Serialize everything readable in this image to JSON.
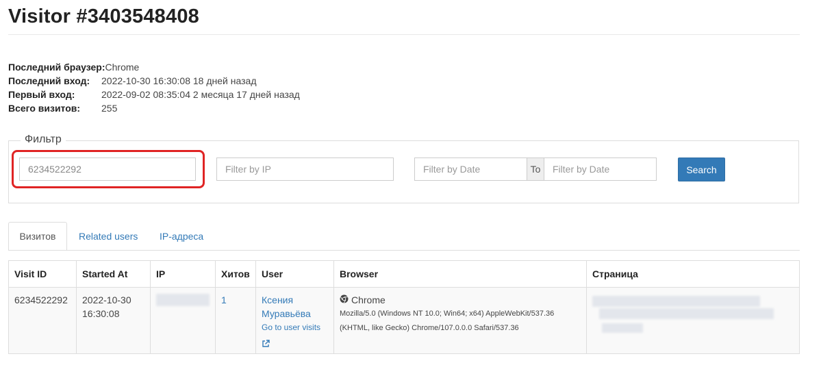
{
  "title": "Visitor #3403548408",
  "info": [
    {
      "key": "Последний браузер:",
      "value": "Chrome"
    },
    {
      "key": "Последний вход:",
      "value": "2022-10-30 16:30:08 18 дней назад"
    },
    {
      "key": "Первый вход:",
      "value": "2022-09-02 08:35:04 2 месяца 17 дней назад"
    },
    {
      "key": "Всего визитов:",
      "value": "255"
    }
  ],
  "filter": {
    "legend": "Фильтр",
    "visitor_value": "6234522292",
    "ip_placeholder": "Filter by IP",
    "date_from_placeholder": "Filter by Date",
    "to_label": "To",
    "date_to_placeholder": "Filter by Date",
    "search_label": "Search"
  },
  "tabs": [
    {
      "label": "Визитов",
      "active": true
    },
    {
      "label": "Related users",
      "active": false
    },
    {
      "label": "IP-адреса",
      "active": false
    }
  ],
  "table": {
    "headers": [
      "Visit ID",
      "Started At",
      "IP",
      "Хитов",
      "User",
      "Browser",
      "Страница"
    ],
    "rows": [
      {
        "visit_id": "6234522292",
        "started_date": "2022-10-30",
        "started_time": "16:30:08",
        "hits": "1",
        "user_first": "Ксения",
        "user_last": "Муравьёва",
        "user_link": "Go to user visits",
        "browser": "Chrome",
        "ua_line1": "Mozilla/5.0 (Windows NT 10.0; Win64; x64) AppleWebKit/537.36",
        "ua_line2": "(KHTML, like Gecko) Chrome/107.0.0.0 Safari/537.36"
      }
    ]
  },
  "colors": {
    "accent": "#337ab7",
    "highlight": "#e02424"
  },
  "icons": {
    "browser": "chrome-icon",
    "user_link": "external-link-icon"
  }
}
